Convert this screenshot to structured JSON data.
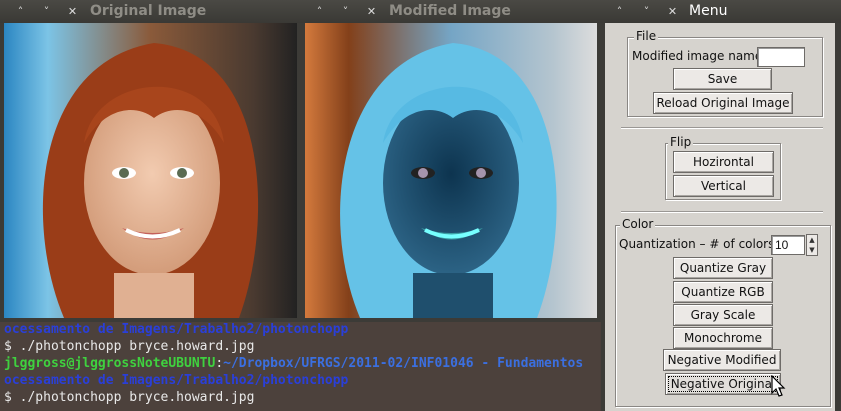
{
  "terminal": {
    "lines": [
      {
        "parts": [
          {
            "cls": "t-blue",
            "text": "ocessamento de Imagens/Trabalho2/photonchopp"
          }
        ]
      },
      {
        "parts": [
          {
            "cls": "t-white",
            "text": "$ ./photonchopp bryce.howard.jpg"
          }
        ]
      },
      {
        "parts": [
          {
            "cls": "t-green",
            "text": "jlggross@jlggrossNoteUBUNTU"
          },
          {
            "cls": "t-white",
            "text": ":"
          },
          {
            "cls": "t-path",
            "text": "~/Dropbox/UFRGS/2011-02/INF01046 - Fundamentos"
          }
        ]
      },
      {
        "parts": [
          {
            "cls": "t-blue",
            "text": "ocessamento de Imagens/Trabalho2/photonchopp"
          }
        ]
      },
      {
        "parts": [
          {
            "cls": "t-white",
            "text": "$ ./photonchopp bryce.howard.jpg"
          }
        ]
      }
    ]
  },
  "windows": {
    "original": {
      "title": "Original Image",
      "buttons": [
        "˄",
        "˅",
        "✕"
      ]
    },
    "modified": {
      "title": "Modified Image",
      "buttons": [
        "˄",
        "˅",
        "✕"
      ]
    },
    "menu": {
      "title": "Menu",
      "buttons": [
        "˄",
        "˅",
        "✕"
      ]
    }
  },
  "file_group": {
    "legend": "File",
    "modified_name_label": "Modified image name:",
    "modified_name_value": "",
    "save": "Save",
    "reload": "Reload Original Image"
  },
  "flip_group": {
    "legend": "Flip",
    "horizontal": "Hozirontal",
    "vertical": "Vertical"
  },
  "color_group": {
    "legend": "Color",
    "quant_label": "Quantization – # of colors:",
    "quant_value": "10",
    "quantize_gray": "Quantize Gray",
    "quantize_rgb": "Quantize RGB",
    "gray_scale": "Gray Scale",
    "monochrome": "Monochrome",
    "negative_modified": "Negative Modified",
    "negative_original": "Negative Original"
  }
}
